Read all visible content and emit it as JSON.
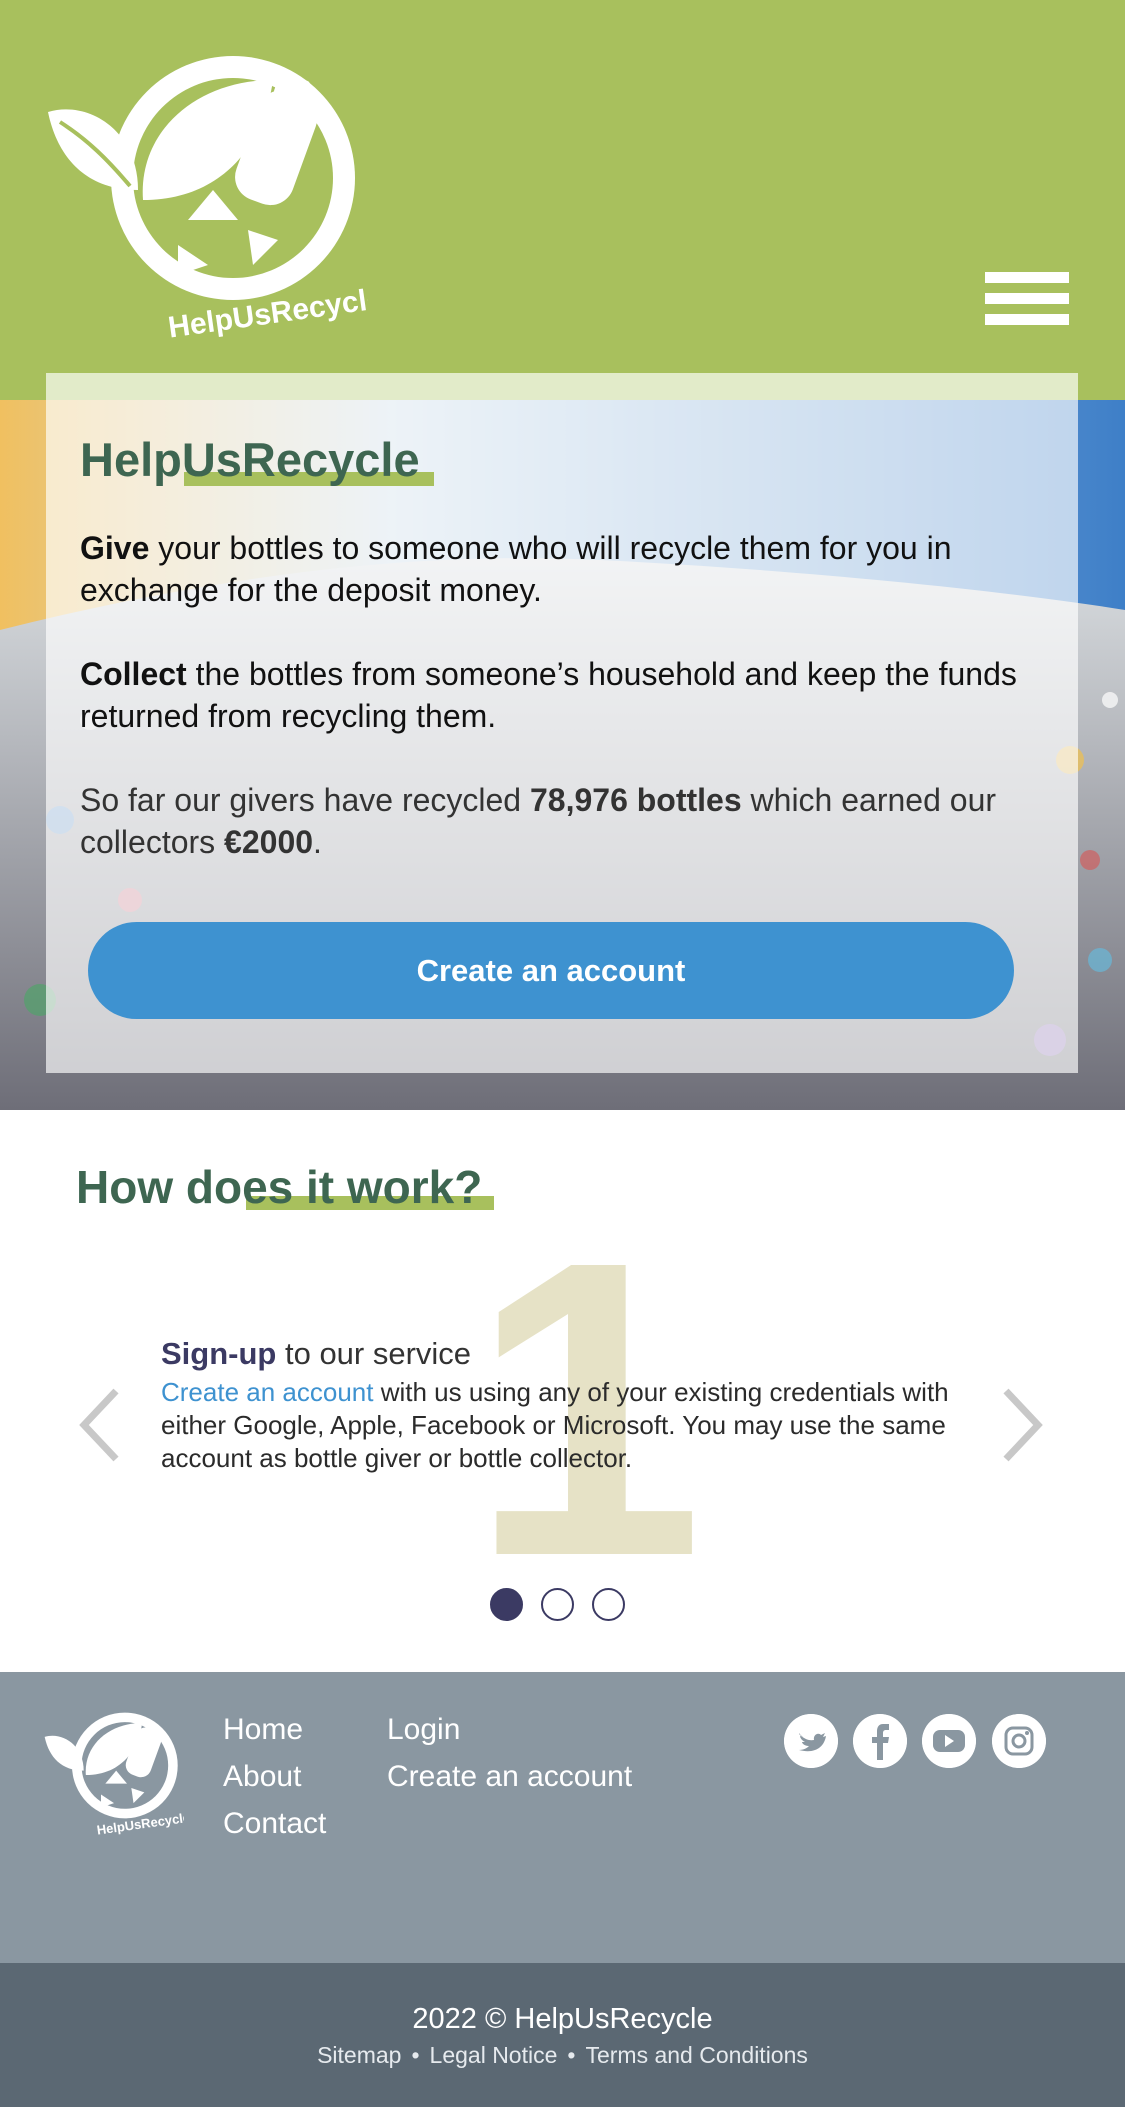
{
  "header": {
    "logo_text": "HelpUsRecycle",
    "menu_icon": "hamburger-menu-icon"
  },
  "hero": {
    "title": "HelpUsRecycle",
    "give_bold": "Give",
    "give_text": " your bottles to someone who will recycle them for you in exchange for the deposit money.",
    "collect_bold": "Collect",
    "collect_text": " the bottles from someone’s household and keep the funds returned from recycling them.",
    "stats_prefix": "So far our givers have recycled ",
    "stats_bottles": "78,976 bottles",
    "stats_middle": " which earned our collectors ",
    "stats_amount": "€2000",
    "stats_suffix": ".",
    "cta_label": "Create an account"
  },
  "how": {
    "title": "How does it work?",
    "step_number": "1",
    "step_head_bold": "Sign-up",
    "step_head_text": " to our service",
    "step_link": "Create an account",
    "step_body": " with us using any of your existing credentials with either Google, Apple, Facebook or Microsoft. You may use the same account as bottle giver or bottle collector.",
    "dots": [
      true,
      false,
      false
    ]
  },
  "footer": {
    "col1": [
      "Home",
      "About",
      "Contact"
    ],
    "col2": [
      "Login",
      "Create an account"
    ],
    "social": [
      "twitter-icon",
      "facebook-icon",
      "youtube-icon",
      "instagram-icon"
    ],
    "copyright": "2022 © HelpUsRecycle",
    "legal": [
      "Sitemap",
      "Legal Notice",
      "Terms and Conditions"
    ]
  },
  "colors": {
    "brand_green": "#a8c05d",
    "heading_green": "#3e6651",
    "cta_blue": "#3e92d0",
    "footer_gray": "#8a97a1",
    "bottom_bar": "#5b6873",
    "accent_navy": "#3b3a63"
  }
}
